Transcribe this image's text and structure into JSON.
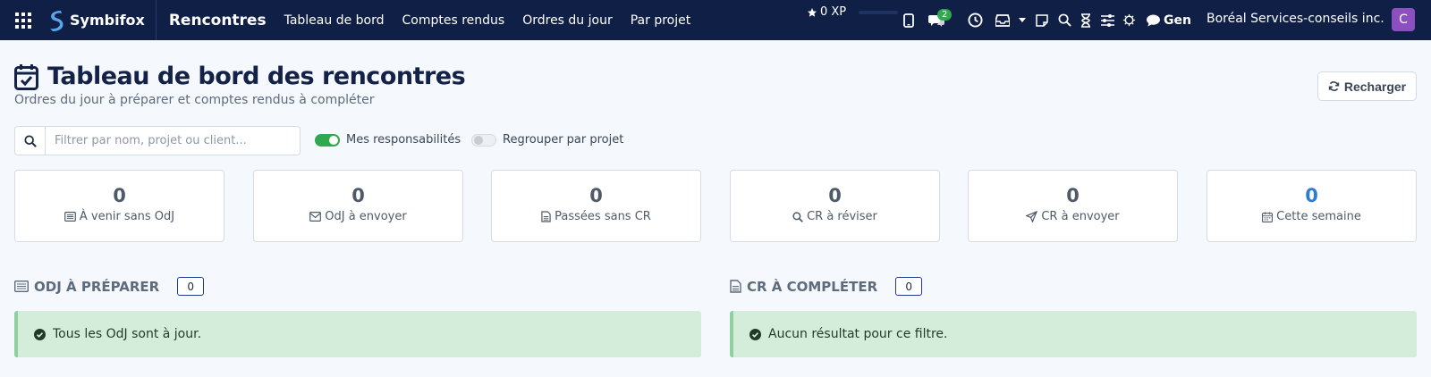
{
  "navbar": {
    "brand": "Symbifox",
    "app_title": "Rencontres",
    "menu": [
      "Tableau de bord",
      "Comptes rendus",
      "Ordres du jour",
      "Par projet"
    ],
    "xp": "0 XP",
    "chat_badge": "2",
    "gen": "Gen",
    "company": "Boréal Services-conseils inc.",
    "avatar": "C"
  },
  "header": {
    "title": "Tableau de bord des rencontres",
    "subtitle": "Ordres du jour à préparer et comptes rendus à compléter",
    "reload": "Recharger"
  },
  "filters": {
    "search_placeholder": "Filtrer par nom, projet ou client...",
    "toggle_mine": "Mes responsabilités",
    "toggle_mine_on": true,
    "toggle_group": "Regrouper par projet",
    "toggle_group_on": false
  },
  "stats": [
    {
      "value": "0",
      "label": "À venir sans OdJ",
      "icon": "list-icon"
    },
    {
      "value": "0",
      "label": "OdJ à envoyer",
      "icon": "envelope-icon"
    },
    {
      "value": "0",
      "label": "Passées sans CR",
      "icon": "document-icon"
    },
    {
      "value": "0",
      "label": "CR à réviser",
      "icon": "search-icon"
    },
    {
      "value": "0",
      "label": "CR à envoyer",
      "icon": "send-icon"
    },
    {
      "value": "0",
      "label": "Cette semaine",
      "icon": "calendar-icon"
    }
  ],
  "sections": {
    "odj": {
      "title": "ODJ À PRÉPARER",
      "count": "0",
      "message": "Tous les OdJ sont à jour."
    },
    "cr": {
      "title": "CR À COMPLÉTER",
      "count": "0",
      "message": "Aucun résultat pour ce filtre."
    }
  },
  "colors": {
    "navbar": "#0f1f45",
    "success": "#2fa84f",
    "accent": "#2f7bd4",
    "alert_bg": "#d4eddb"
  }
}
